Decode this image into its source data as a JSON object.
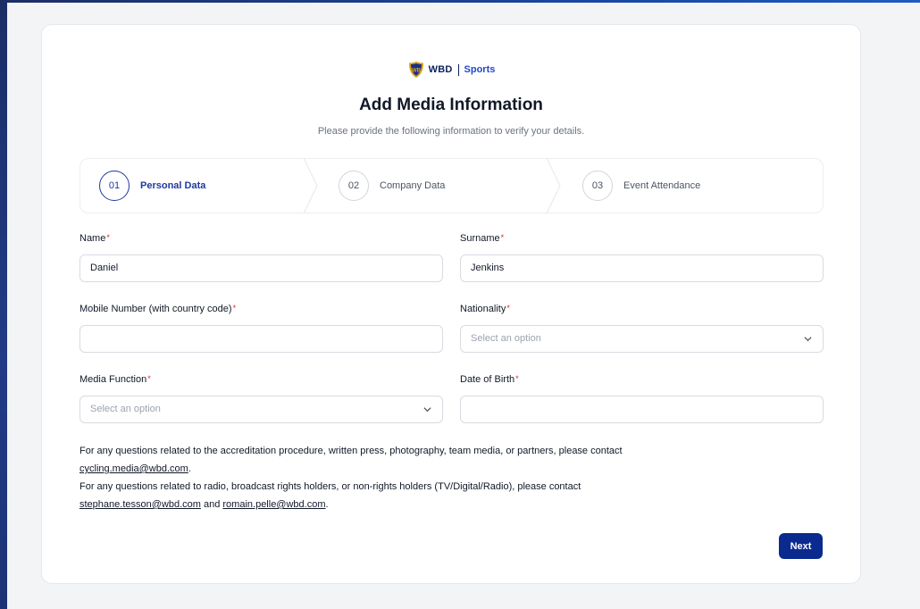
{
  "brand": {
    "wbd": "WBD",
    "sports": "Sports"
  },
  "header": {
    "title": "Add Media Information",
    "subtitle": "Please provide the following information to verify your details."
  },
  "steps": [
    {
      "number": "01",
      "label": "Personal Data",
      "active": true
    },
    {
      "number": "02",
      "label": "Company Data",
      "active": false
    },
    {
      "number": "03",
      "label": "Event Attendance",
      "active": false
    }
  ],
  "form": {
    "name": {
      "label": "Name",
      "value": "Daniel",
      "required": "*"
    },
    "surname": {
      "label": "Surname",
      "value": "Jenkins",
      "required": "*"
    },
    "mobile": {
      "label": "Mobile Number (with country code)",
      "value": "",
      "required": "*"
    },
    "nationality": {
      "label": "Nationality",
      "placeholder": "Select an option",
      "required": "*"
    },
    "media_function": {
      "label": "Media Function",
      "placeholder": "Select an option",
      "required": "*"
    },
    "dob": {
      "label": "Date of Birth",
      "value": "",
      "required": "*"
    }
  },
  "info": {
    "line1": "For any questions related to the accreditation procedure, written press, photography, team media, or partners, please contact",
    "email1": "cycling.media@wbd.com",
    "dot1": ".",
    "line2": "For any questions related to radio, broadcast rights holders, or non-rights holders (TV/Digital/Radio), please contact",
    "email2": "stephane.tesson@wbd.com",
    "and": " and ",
    "email3": "romain.pelle@wbd.com",
    "dot2": "."
  },
  "actions": {
    "next": "Next"
  },
  "colors": {
    "primary": "#0b2a8f",
    "required": "#e02424",
    "logo_gold": "#d9a21b"
  }
}
